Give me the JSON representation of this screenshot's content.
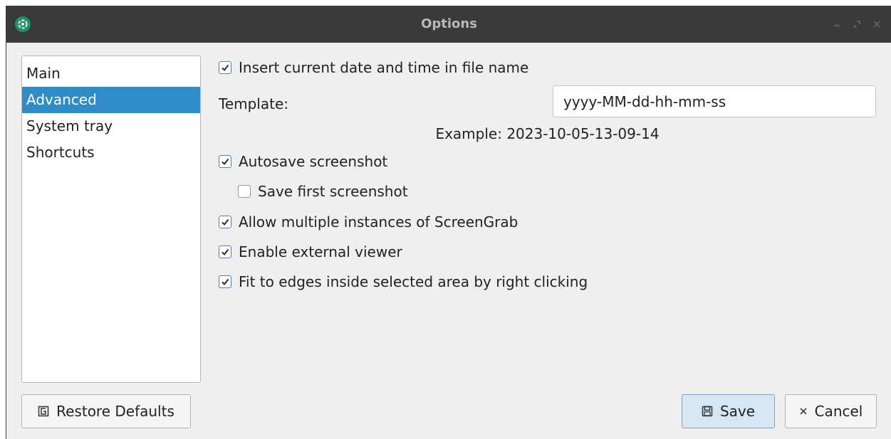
{
  "window": {
    "title": "Options",
    "app_icon": "screengrab-app-icon",
    "controls": [
      "minimize-icon",
      "restore-icon",
      "close-icon"
    ]
  },
  "sidebar": {
    "items": [
      {
        "label": "Main",
        "selected": false
      },
      {
        "label": "Advanced",
        "selected": true
      },
      {
        "label": "System tray",
        "selected": false
      },
      {
        "label": "Shortcuts",
        "selected": false
      }
    ]
  },
  "advanced": {
    "insert_datetime": {
      "label": "Insert current date and time in file name",
      "checked": true
    },
    "template": {
      "label": "Template:",
      "value": "yyyy-MM-dd-hh-mm-ss"
    },
    "example": "Example: 2023-10-05-13-09-14",
    "autosave": {
      "label": "Autosave screenshot",
      "checked": true
    },
    "save_first": {
      "label": "Save first screenshot",
      "checked": false
    },
    "multiple_instances": {
      "label": "Allow multiple instances of ScreenGrab",
      "checked": true
    },
    "external_viewer": {
      "label": "Enable external viewer",
      "checked": true
    },
    "fit_edges": {
      "label": "Fit to edges inside selected area by right clicking",
      "checked": true
    }
  },
  "buttons": {
    "restore_defaults": {
      "label": "Restore Defaults",
      "icon": "restore-icon"
    },
    "save": {
      "label": "Save",
      "icon": "floppy-disk-icon"
    },
    "cancel": {
      "label": "Cancel",
      "icon": "close-x-icon"
    }
  },
  "colors": {
    "titlebar": "#3a3a3a",
    "selection": "#308cc6",
    "app_icon": "#1f8f6e"
  }
}
